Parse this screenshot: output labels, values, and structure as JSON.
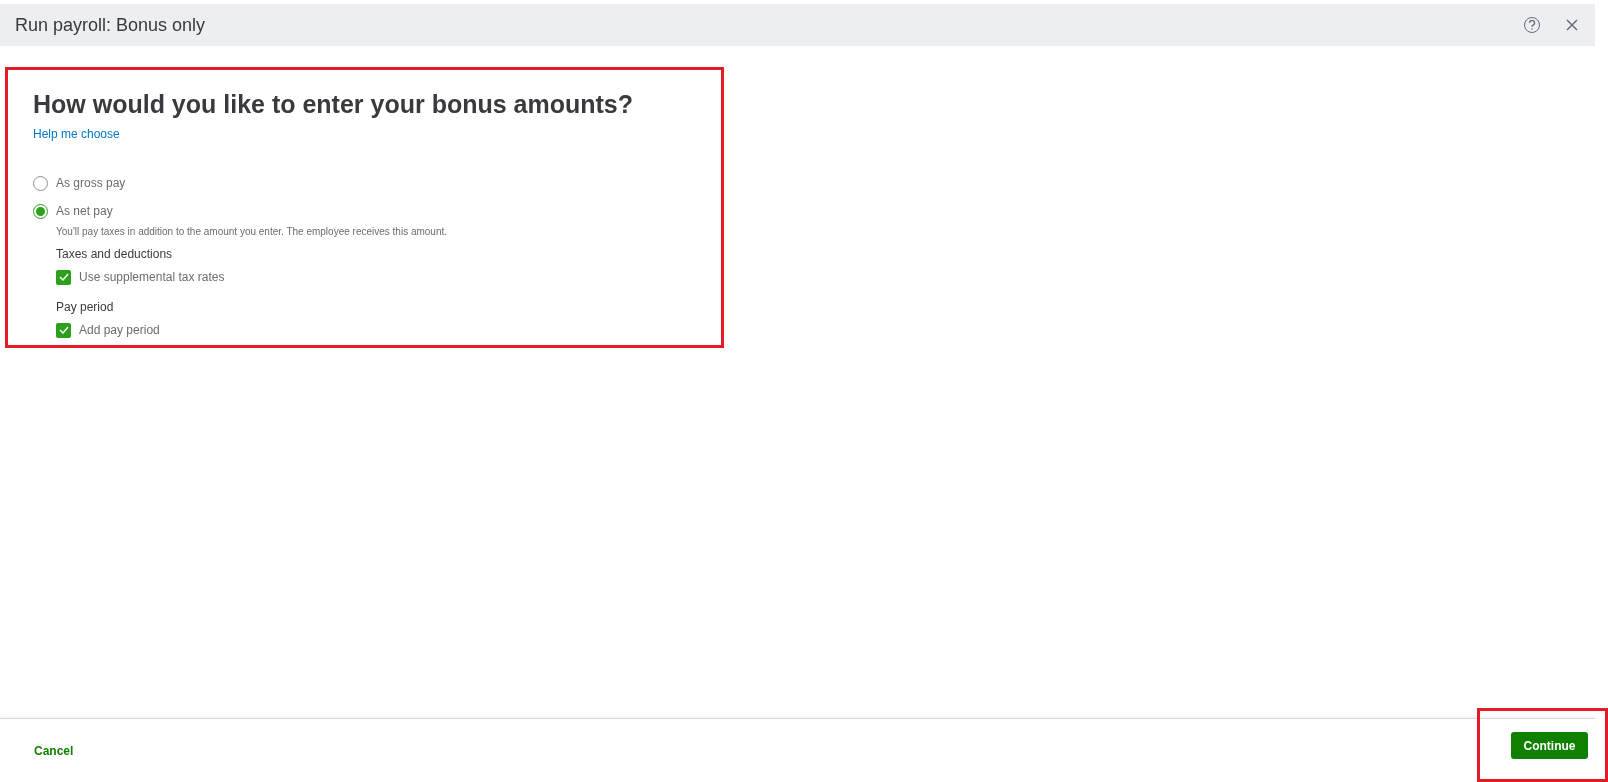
{
  "window": {
    "title": "Run payroll: Bonus only"
  },
  "question": {
    "title": "How would you like to enter your bonus amounts?",
    "help_link": "Help me choose"
  },
  "options": [
    {
      "label": "As gross pay",
      "selected": false
    },
    {
      "label": "As net pay",
      "selected": true,
      "description": "You'll pay taxes in addition to the amount you enter. The employee receives this amount."
    }
  ],
  "sections": [
    {
      "label": "Taxes and deductions",
      "checkbox": {
        "label": "Use supplemental tax rates",
        "checked": true
      }
    },
    {
      "label": "Pay period",
      "checkbox": {
        "label": "Add pay period",
        "checked": true
      }
    }
  ],
  "footer": {
    "cancel": "Cancel",
    "continue": "Continue"
  }
}
